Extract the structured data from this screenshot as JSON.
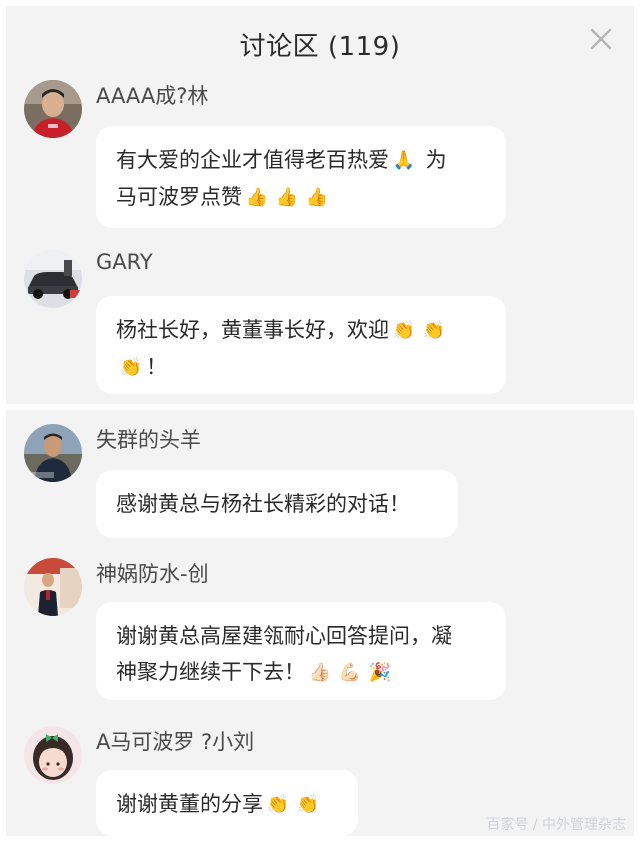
{
  "header": {
    "title": "讨论区 (119)"
  },
  "colors": {
    "panel_bg": "#f3f3f4",
    "bubble_bg": "#ffffff",
    "username": "#4a4a4a",
    "text": "#2a2a2a",
    "close_icon": "#b5b5b5",
    "watermark": "#cfd3d8"
  },
  "comments": [
    {
      "username": "AAAA成?林",
      "lines": [
        {
          "text": "有大爱的企业才值得老百热爱",
          "emojis": [
            "🙏"
          ],
          "after": " 为"
        },
        {
          "text": "马可波罗点赞",
          "emojis": [
            "👍",
            "👍",
            "👍"
          ],
          "after": ""
        }
      ],
      "avatar_icon": "man-portrait-red-shirt-icon"
    },
    {
      "username": "GARY",
      "lines": [
        {
          "text": "杨社长好，黄董事长好，欢迎",
          "emojis": [
            "👏",
            "👏"
          ],
          "after": ""
        },
        {
          "text": "",
          "emojis": [
            "👏"
          ],
          "after": "！"
        }
      ],
      "avatar_icon": "car-photo-icon"
    },
    {
      "username": "失群的头羊",
      "lines": [
        {
          "text": "感谢黄总与杨社长精彩的对话！",
          "emojis": [],
          "after": ""
        }
      ],
      "avatar_icon": "man-outdoor-portrait-icon"
    },
    {
      "username": "神娲防水-创",
      "lines": [
        {
          "text": "谢谢黄总高屋建瓴耐心回答提问，凝",
          "emojis": [],
          "after": ""
        },
        {
          "text": "神聚力继续干下去！",
          "emojis": [
            "👍🏻",
            "💪🏻",
            "🎉"
          ],
          "after": ""
        }
      ],
      "avatar_icon": "man-suit-stage-icon"
    },
    {
      "username": "A马可波罗 ?小刘",
      "lines": [
        {
          "text": "谢谢黄董的分享",
          "emojis": [
            "👏",
            "👏"
          ],
          "after": ""
        }
      ],
      "avatar_icon": "girl-cartoon-bow-icon"
    }
  ],
  "watermark": "百家号 / 中外管理杂志",
  "close_icon": "close-icon"
}
